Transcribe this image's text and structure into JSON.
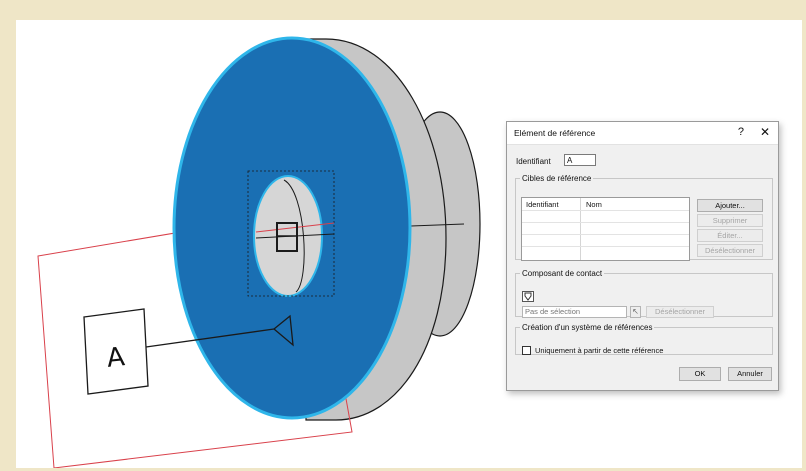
{
  "scene": {
    "datum_letter": "A",
    "colors": {
      "face": "#1a6fb3",
      "face_edge": "#2fb6ea",
      "body": "#c6c6c6",
      "plane": "#e0525a",
      "line": "#111111"
    }
  },
  "dialog": {
    "title": "Elément de référence",
    "help": "?",
    "close": "✕",
    "identifier_label": "Identifiant",
    "identifier_value": "A",
    "cibles": {
      "legend": "Cibles de référence",
      "columns": [
        "Identifiant",
        "Nom"
      ],
      "buttons": [
        "Ajouter...",
        "Supprimer",
        "Éditer...",
        "Désélectionner"
      ]
    },
    "contact": {
      "legend": "Composant de contact",
      "icon": "pin-icon",
      "selection_placeholder": "Pas de sélection",
      "select_button": "Désélectionner"
    },
    "systeme": {
      "legend": "Création d'un système de références",
      "checkbox_label": "Uniquement à partir de cette référence",
      "checked": false
    },
    "ok_label": "OK",
    "cancel_label": "Annuler"
  }
}
